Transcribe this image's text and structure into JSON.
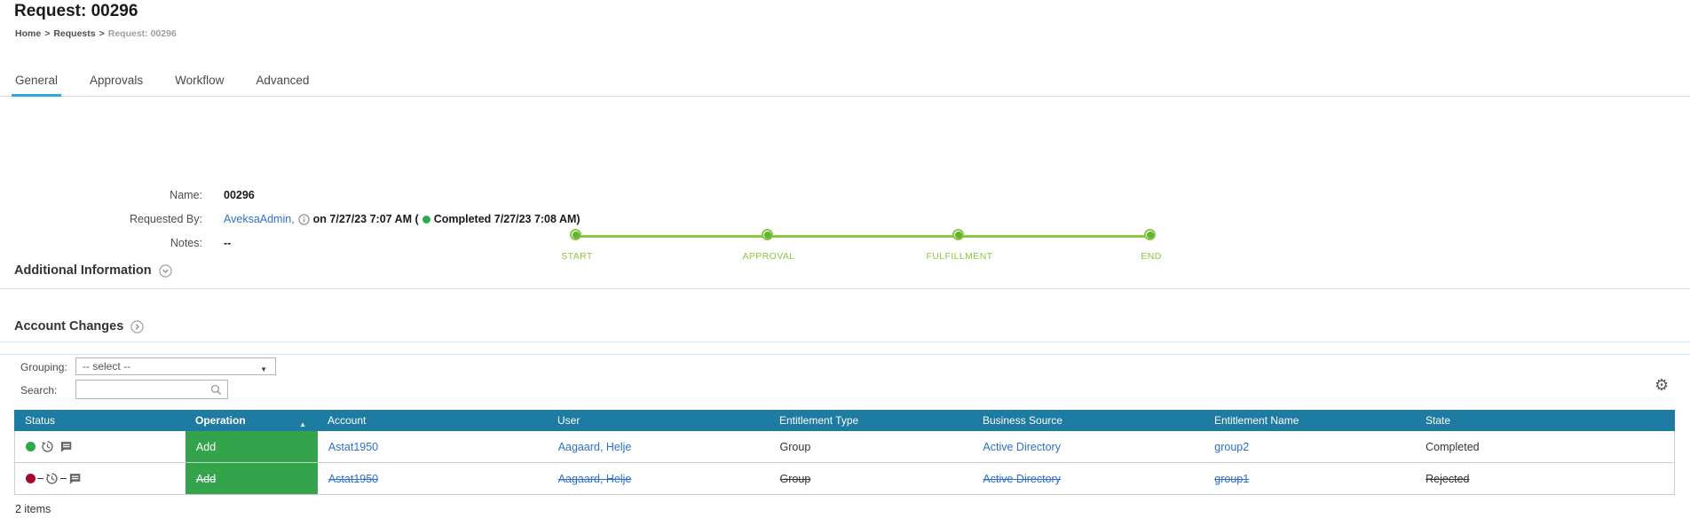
{
  "page": {
    "title": "Request: 00296"
  },
  "breadcrumb": {
    "separator": ">",
    "items": [
      {
        "label": "Home"
      },
      {
        "label": "Requests"
      },
      {
        "label": "Request: 00296"
      }
    ]
  },
  "tabs": [
    {
      "label": "General",
      "active": true
    },
    {
      "label": "Approvals",
      "active": false
    },
    {
      "label": "Workflow",
      "active": false
    },
    {
      "label": "Advanced",
      "active": false
    }
  ],
  "timeline": {
    "steps": [
      "START",
      "APPROVAL",
      "FULFILLMENT",
      "END"
    ]
  },
  "details": {
    "name_label": "Name:",
    "name_value": "00296",
    "requested_by_label": "Requested By:",
    "requested_by_user": "AveksaAdmin,",
    "requested_by_text": "on 7/27/23 7:07 AM (",
    "completed_text": "Completed 7/27/23 7:08 AM)",
    "notes_label": "Notes:",
    "notes_value": "--"
  },
  "sections": {
    "additional_information": "Additional Information",
    "account_changes": "Account Changes"
  },
  "toolbar": {
    "grouping_label": "Grouping:",
    "grouping_value": "-- select --",
    "search_label": "Search:",
    "search_value": ""
  },
  "icons": {
    "dropdown_caret": "▼",
    "sort_asc": "▲",
    "gear": "⚙"
  },
  "table": {
    "columns": [
      {
        "label": "Status"
      },
      {
        "label": "Operation",
        "sorted": "ascending"
      },
      {
        "label": "Account"
      },
      {
        "label": "User"
      },
      {
        "label": "Entitlement Type"
      },
      {
        "label": "Business Source"
      },
      {
        "label": "Entitlement Name"
      },
      {
        "label": "State"
      }
    ],
    "rows": [
      {
        "status": "completed",
        "operation": "Add",
        "account": "Astat1950",
        "user": "Aagaard, Helje",
        "entitlement_type": "Group",
        "business_source": "Active Directory",
        "entitlement_name": "group2",
        "state": "Completed"
      },
      {
        "status": "rejected",
        "operation": "Add",
        "account": "Astat1950",
        "user": "Aagaard, Helje",
        "entitlement_type": "Group",
        "business_source": "Active Directory",
        "entitlement_name": "group1",
        "state": "Rejected"
      }
    ],
    "footer": "2 items"
  },
  "colors": {
    "accent_tab": "#29a9df",
    "timeline_green": "#8dc63f",
    "table_header_bg": "#1e7ca3",
    "operation_add_bg": "#34a44c",
    "link": "#2e6fcd",
    "status_completed_dot": "#2fa84c",
    "status_rejected_dot": "#a30b2e",
    "section_divider": "#cfe9f5"
  }
}
